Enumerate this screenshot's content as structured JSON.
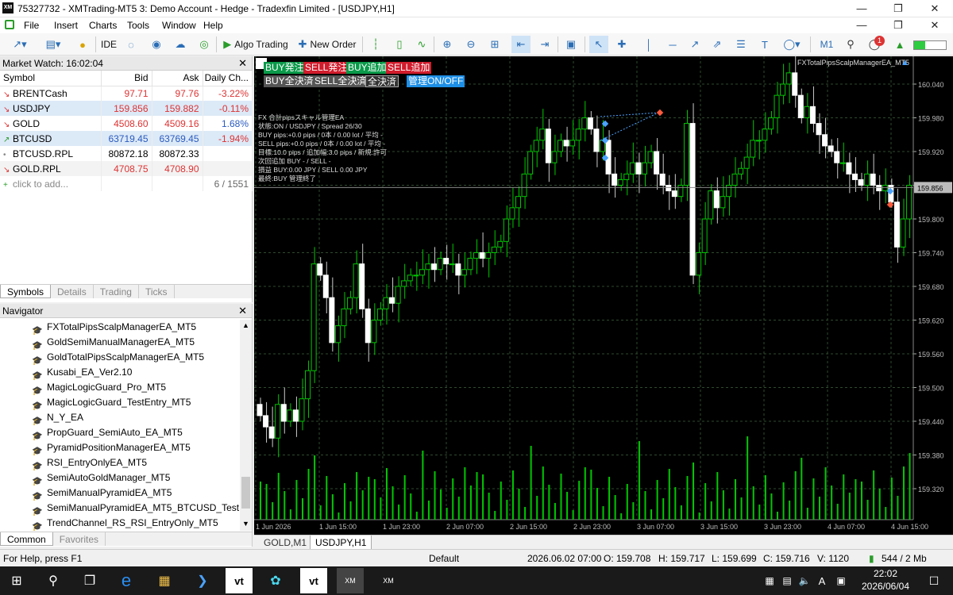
{
  "window": {
    "title": "75327732 - XMTrading-MT5 3: Demo Account - Hedge - Tradexfin Limited - [USDJPY,H1]",
    "logo": "XM"
  },
  "menu": [
    "File",
    "Insert",
    "Charts",
    "Tools",
    "Window",
    "Help"
  ],
  "toolbar": {
    "algo_trading": "Algo Trading",
    "new_order": "New Order",
    "timeframe": "M1",
    "ide": "IDE",
    "notif_count": "1"
  },
  "market_watch": {
    "title": "Market Watch: 16:02:04",
    "columns": [
      "Symbol",
      "Bid",
      "Ask",
      "Daily Ch..."
    ],
    "rows": [
      {
        "symbol": "BRENTCash",
        "bid": "97.71",
        "ask": "97.76",
        "change": "-3.22%",
        "dir": "down"
      },
      {
        "symbol": "USDJPY",
        "bid": "159.856",
        "ask": "159.882",
        "change": "-0.11%",
        "dir": "down"
      },
      {
        "symbol": "GOLD",
        "bid": "4508.60",
        "ask": "4509.16",
        "change": "1.68%",
        "dir": "down"
      },
      {
        "symbol": "BTCUSD",
        "bid": "63719.45",
        "ask": "63769.45",
        "change": "-1.94%",
        "dir": "up"
      },
      {
        "symbol": "BTCUSD.RPL",
        "bid": "80872.18",
        "ask": "80872.33",
        "change": "",
        "dir": "none"
      },
      {
        "symbol": "GOLD.RPL",
        "bid": "4708.75",
        "ask": "4708.90",
        "change": "",
        "dir": "down"
      }
    ],
    "add_label": "click to add...",
    "count": "6 / 1551",
    "tabs": [
      "Symbols",
      "Details",
      "Trading",
      "Ticks"
    ]
  },
  "navigator": {
    "title": "Navigator",
    "items": [
      "FXTotalPipsScalpManagerEA_MT5",
      "GoldSemiManualManagerEA_MT5",
      "GoldTotalPipsScalpManagerEA_MT5",
      "Kusabi_EA_Ver2.10",
      "MagicLogicGuard_Pro_MT5",
      "MagicLogicGuard_TestEntry_MT5",
      "N_Y_EA",
      "PropGuard_SemiAuto_EA_MT5",
      "PyramidPositionManagerEA_MT5",
      "RSI_EntryOnlyEA_MT5",
      "SemiAutoGoldManager_MT5",
      "SemiManualPyramidEA_MT5",
      "SemiManualPyramidEA_MT5_BTCUSD_Test",
      "TrendChannel_RS_RSI_EntryOnly_MT5"
    ],
    "tabs": [
      "Common",
      "Favorites"
    ]
  },
  "chart": {
    "ea_name": "FXTotalPipsScalpManagerEA_MT5",
    "buttons_row1": [
      "BUY発注",
      "SELL発注",
      "BUY追加",
      "SELL追加"
    ],
    "buttons_row2": [
      "BUY全決済",
      "SELL全決済",
      "全決済",
      "管理ON/OFF"
    ],
    "info": [
      "FX 合計pipsスキャル管理EA",
      "状態:ON / USDJPY / Spread 26/30",
      "BUY pips:+0.0 pips / 0本 / 0.00 lot / 平均 -",
      "SELL pips:+0.0 pips / 0本 / 0.00 lot / 平均 -",
      "目標:10.0 pips / 追加幅:3.0 pips / 新規:許可",
      "次回追加 BUY - / SELL -",
      "損益 BUY:0.00 JPY / SELL 0.00 JPY",
      "最終:BUY 管理終了"
    ],
    "price_labels": [
      "160.040",
      "159.980",
      "159.920",
      "159.860",
      "159.800",
      "159.740",
      "159.680",
      "159.620",
      "159.560",
      "159.500",
      "159.440",
      "159.380",
      "159.320"
    ],
    "current_price": "159.856",
    "time_labels": [
      "1 Jun 2026",
      "1 Jun 15:00",
      "1 Jun 23:00",
      "2 Jun 07:00",
      "2 Jun 15:00",
      "2 Jun 23:00",
      "3 Jun 07:00",
      "3 Jun 15:00",
      "3 Jun 23:00",
      "4 Jun 07:00",
      "4 Jun 15:00"
    ],
    "tabs": [
      "GOLD,M1",
      "USDJPY,H1"
    ],
    "colors": {
      "bg": "#000000",
      "bull": "#00c800",
      "bear": "#ffffff",
      "grid": "#2e4a2e",
      "volume": "#00c800"
    }
  },
  "status": {
    "help": "For Help, press F1",
    "profile": "Default",
    "time": "2026.06.02 07:00",
    "open": "O: 159.708",
    "high": "H: 159.717",
    "low": "L: 159.699",
    "close": "C: 159.716",
    "volume": "V: 1120",
    "traffic": "544 / 2 Mb"
  },
  "taskbar": {
    "time": "22:02",
    "date": "2026/06/04"
  }
}
